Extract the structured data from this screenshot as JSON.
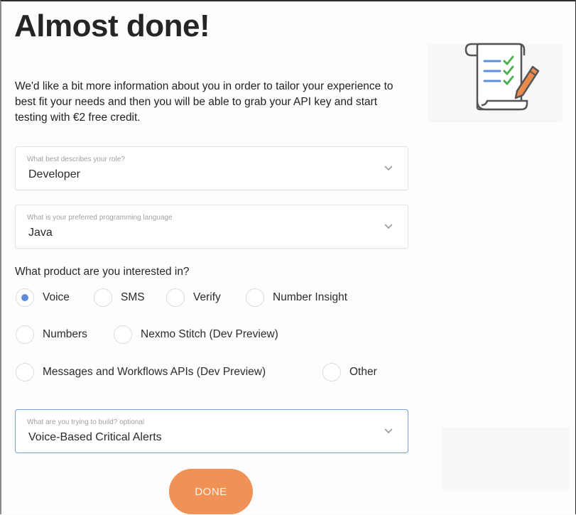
{
  "heading": "Almost done!",
  "intro": "We'd like a bit more information about you in order to tailor your experience to best fit your needs and then you will be able to grab your API key and start testing with €2 free credit.",
  "role_field": {
    "label": "What best describes your role?",
    "value": "Developer"
  },
  "language_field": {
    "label": "What is your preferred programming language",
    "value": "Java"
  },
  "products": {
    "question": "What product are you interested in?",
    "options": [
      {
        "label": "Voice",
        "selected": true
      },
      {
        "label": "SMS",
        "selected": false
      },
      {
        "label": "Verify",
        "selected": false
      },
      {
        "label": "Number Insight",
        "selected": false
      },
      {
        "label": "Numbers",
        "selected": false
      },
      {
        "label": "Nexmo Stitch (Dev Preview)",
        "selected": false
      },
      {
        "label": "Messages and Workflows APIs (Dev Preview)",
        "selected": false
      },
      {
        "label": "Other",
        "selected": false
      }
    ]
  },
  "build_field": {
    "label": "What are you trying to build? optional",
    "value": "Voice-Based Critical Alerts"
  },
  "done_button": "DONE",
  "colors": {
    "accent_button": "#f09255",
    "radio_selected": "#5b8fdd",
    "active_border": "#7a9fd6",
    "check_green": "#4caf50",
    "icon_blue": "#5a8fd8"
  },
  "icons": {
    "illustration": "checklist-scroll-pencil-icon",
    "dropdown": "chevron-down-icon"
  }
}
